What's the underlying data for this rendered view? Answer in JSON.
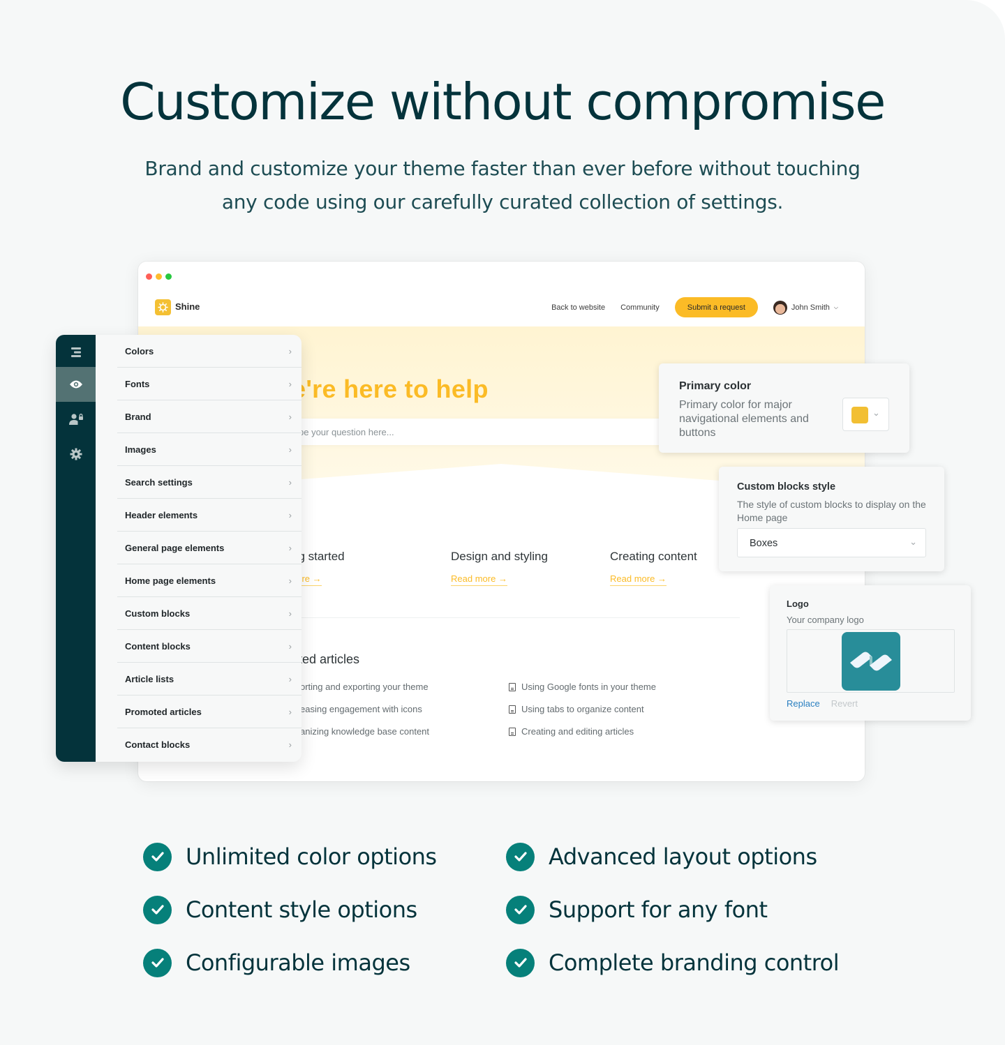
{
  "hero": {
    "title": "Customize without compromise",
    "subtitle_line1": "Brand and customize your theme faster than ever before without touching",
    "subtitle_line2": "any code using our carefully curated collection of settings."
  },
  "browser": {
    "window_dots": [
      "#ff5f57",
      "#febc2e",
      "#28c840"
    ],
    "brand_name": "Shine",
    "brand_icon": "sun-gear-icon",
    "brand_color": "#f4c033",
    "nav": {
      "back_link": "Back to website",
      "community_link": "Community",
      "submit_button": "Submit a request",
      "user_name": "John Smith",
      "user_menu_icon": "chevron-down-icon"
    },
    "hero_title_visible": "e're here to help",
    "search_placeholder_visible": "pe your question here...",
    "accent_color": "#fbbb26",
    "categories": [
      {
        "title": "ng started",
        "link": "nore"
      },
      {
        "title": "Design and styling",
        "link": "Read more"
      },
      {
        "title": "Creating content",
        "link": "Read more"
      }
    ],
    "promoted_title_visible": "oted articles",
    "promoted_left": [
      "orting and exporting your theme",
      "easing engagement with icons",
      "anizing knowledge base content"
    ],
    "promoted_right": [
      "Using Google fonts in your theme",
      "Using tabs to organize content",
      "Creating and editing articles"
    ]
  },
  "settings_panel": {
    "rail_icons": [
      "sections-icon",
      "eye-icon",
      "user-lock-icon",
      "gear-icon"
    ],
    "active_rail_index": 1,
    "menu": [
      "Colors",
      "Fonts",
      "Brand",
      "Images",
      "Search settings",
      "Header elements",
      "General page elements",
      "Home page elements",
      "Custom blocks",
      "Content blocks",
      "Article lists",
      "Promoted articles",
      "Contact blocks"
    ]
  },
  "cards": {
    "primary_color": {
      "title": "Primary color",
      "description": "Primary color for major navigational elements and buttons",
      "value": "#f2bf33"
    },
    "custom_blocks_style": {
      "title": "Custom blocks style",
      "description": "The style of custom blocks to display on the Home page",
      "selected": "Boxes"
    },
    "logo": {
      "title": "Logo",
      "description": "Your company logo",
      "replace_label": "Replace",
      "revert_label": "Revert"
    }
  },
  "features": [
    "Unlimited color options",
    "Advanced layout options",
    "Content style options",
    "Support for any font",
    "Configurable images",
    "Complete branding control"
  ]
}
